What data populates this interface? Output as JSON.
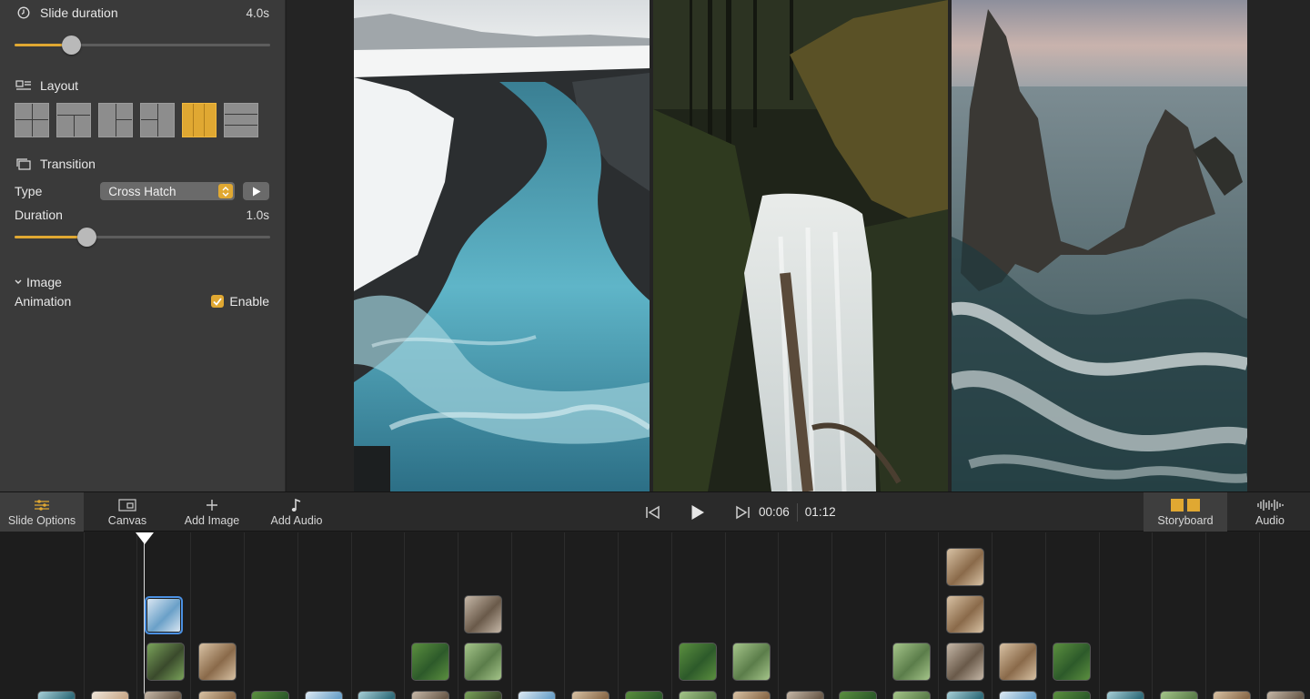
{
  "sidebar": {
    "slide_duration": {
      "label": "Slide duration",
      "value": "4.0s",
      "fraction": 0.22
    },
    "layout": {
      "label": "Layout",
      "selected_index": 4,
      "options": [
        "grid-2x2",
        "grid-2x2-alt",
        "grid-2x2-b",
        "split-3",
        "columns-3",
        "rows-3"
      ]
    },
    "transition": {
      "label": "Transition",
      "type_label": "Type",
      "type_value": "Cross Hatch",
      "duration_label": "Duration",
      "duration_value": "1.0s",
      "fraction": 0.28
    },
    "image": {
      "label": "Image",
      "animation_label": "Animation",
      "enable_label": "Enable",
      "enabled": true
    }
  },
  "preview": {
    "photos": [
      "glacial-river-photo",
      "forest-waterfall-photo",
      "sea-arch-photo"
    ]
  },
  "toolbar": {
    "slide_options": "Slide Options",
    "canvas": "Canvas",
    "add_image": "Add Image",
    "add_audio": "Add Audio",
    "current_time": "00:06",
    "total_time": "01:12",
    "storyboard": "Storyboard",
    "audio": "Audio"
  },
  "colors": {
    "accent": "#e0a832",
    "panel": "#3a3a3a",
    "selection": "#4a90e2"
  }
}
